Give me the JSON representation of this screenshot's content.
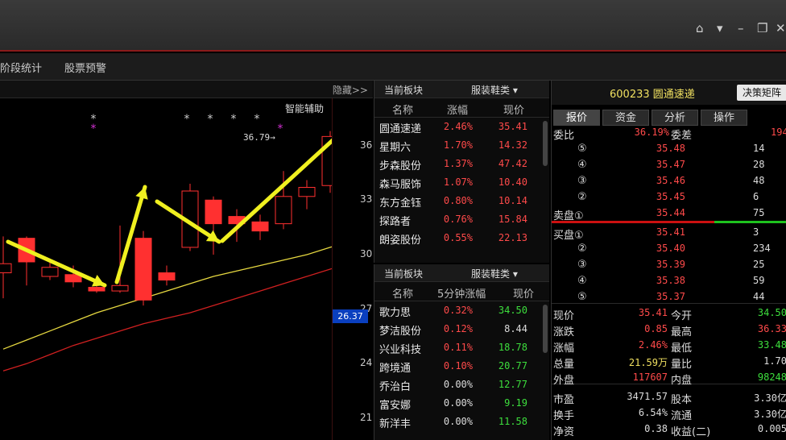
{
  "menubar": {
    "stage_stats": "阶段统计",
    "stock_alert": "股票预警"
  },
  "chart": {
    "hide_label": "隐藏>>",
    "assist_label": "智能辅助",
    "high_marker": "36.79→",
    "current_price": "26.37",
    "y_ticks": [
      "36",
      "33",
      "30",
      "27",
      "24",
      "21"
    ],
    "star_marks": [
      "*",
      "*",
      "*",
      "*",
      "*",
      "*"
    ],
    "purple_marks": [
      "*",
      "*"
    ]
  },
  "chart_data": {
    "type": "candlestick",
    "yaxis_ticks": [
      36,
      33,
      30,
      27,
      24,
      21
    ],
    "ylim": [
      19.8,
      38.6
    ],
    "candles": [
      {
        "open": 29.0,
        "close": 29.5,
        "high": 31.0,
        "low": 27.6
      },
      {
        "open": 30.9,
        "close": 29.6,
        "high": 31.0,
        "low": 28.3
      },
      {
        "open": 28.8,
        "close": 29.3,
        "high": 29.6,
        "low": 28.6
      },
      {
        "open": 28.9,
        "close": 28.5,
        "high": 29.4,
        "low": 28.2
      },
      {
        "open": 28.2,
        "close": 28.0,
        "high": 28.4,
        "low": 27.9
      },
      {
        "open": 28.0,
        "close": 28.3,
        "high": 31.6,
        "low": 27.9
      },
      {
        "open": 30.9,
        "close": 27.5,
        "high": 31.3,
        "low": 27.2
      },
      {
        "open": 29.0,
        "close": 28.6,
        "high": 29.4,
        "low": 28.3
      },
      {
        "open": 30.4,
        "close": 33.5,
        "high": 33.9,
        "low": 30.2
      },
      {
        "open": 33.0,
        "close": 31.7,
        "high": 33.2,
        "low": 30.0
      },
      {
        "open": 32.1,
        "close": 31.7,
        "high": 32.5,
        "low": 30.7
      },
      {
        "open": 31.8,
        "close": 31.3,
        "high": 32.2,
        "low": 30.8
      },
      {
        "open": 31.7,
        "close": 33.2,
        "high": 34.6,
        "low": 31.4
      },
      {
        "open": 33.2,
        "close": 33.7,
        "high": 34.1,
        "low": 32.5
      },
      {
        "open": 33.8,
        "close": 36.5,
        "high": 36.8,
        "low": 33.4
      },
      {
        "open": 36.3,
        "close": 34.9,
        "high": 36.79,
        "low": 34.5
      },
      {
        "open": 34.8,
        "close": 35.9,
        "high": 37.1,
        "low": 33.8
      }
    ],
    "ma_yellow": [
      24.8,
      25.3,
      25.8,
      26.3,
      26.8,
      27.2,
      27.6,
      28.0,
      28.4,
      28.8,
      29.1,
      29.4,
      29.7,
      30.0,
      30.4,
      30.8,
      31.2
    ],
    "ma_red": [
      23.6,
      24.0,
      24.5,
      25.0,
      25.4,
      25.8,
      26.2,
      26.5,
      26.8,
      27.2,
      27.6,
      28.0,
      28.4,
      28.8,
      29.2,
      29.6,
      30.0
    ]
  },
  "sector1": {
    "title": "当前板块",
    "select": "服装鞋类 ▾",
    "headers": [
      "名称",
      "涨幅",
      "现价"
    ],
    "rows": [
      {
        "name": "圆通速递",
        "chg": "2.46%",
        "price": "35.41",
        "color": "up"
      },
      {
        "name": "星期六",
        "chg": "1.70%",
        "price": "14.32",
        "color": "up"
      },
      {
        "name": "步森股份",
        "chg": "1.37%",
        "price": "47.42",
        "color": "up"
      },
      {
        "name": "森马服饰",
        "chg": "1.07%",
        "price": "10.40",
        "color": "up"
      },
      {
        "name": "东方金钰",
        "chg": "0.80%",
        "price": "10.14",
        "color": "up"
      },
      {
        "name": "探路者",
        "chg": "0.76%",
        "price": "15.84",
        "color": "up"
      },
      {
        "name": "朗姿股份",
        "chg": "0.55%",
        "price": "22.13",
        "color": "up"
      }
    ]
  },
  "sector2": {
    "title": "当前板块",
    "select": "服装鞋类 ▾",
    "headers": [
      "名称",
      "5分钟涨幅",
      "现价"
    ],
    "rows": [
      {
        "name": "歌力思",
        "chg": "0.32%",
        "price": "34.50",
        "color": "down"
      },
      {
        "name": "梦洁股份",
        "chg": "0.12%",
        "price": "8.44",
        "color": "flat"
      },
      {
        "name": "兴业科技",
        "chg": "0.11%",
        "price": "18.78",
        "color": "down"
      },
      {
        "name": "跨境通",
        "chg": "0.10%",
        "price": "20.77",
        "color": "down"
      },
      {
        "name": "乔治白",
        "chg": "0.00%",
        "price": "12.77",
        "color": "down"
      },
      {
        "name": "富安娜",
        "chg": "0.00%",
        "price": "9.19",
        "color": "down"
      },
      {
        "name": "新洋丰",
        "chg": "0.00%",
        "price": "11.58",
        "color": "down"
      }
    ]
  },
  "quote": {
    "code_name": "600233 圆通速递",
    "decision_btn": "决策矩阵",
    "tabs": [
      "报价",
      "资金",
      "分析",
      "操作"
    ],
    "weibi_label": "委比",
    "weibi_value": "36.19%",
    "weicha_label": "委差",
    "weicha_value": "194",
    "sell": [
      {
        "lv": "⑤",
        "price": "35.48",
        "vol": "14"
      },
      {
        "lv": "④",
        "price": "35.47",
        "vol": "28"
      },
      {
        "lv": "③",
        "price": "35.46",
        "vol": "48"
      },
      {
        "lv": "②",
        "price": "35.45",
        "vol": "6"
      },
      {
        "lv": "卖盘①",
        "price": "35.44",
        "vol": "75"
      }
    ],
    "buy": [
      {
        "lv": "买盘①",
        "price": "35.41",
        "vol": "3"
      },
      {
        "lv": "②",
        "price": "35.40",
        "vol": "234"
      },
      {
        "lv": "③",
        "price": "35.39",
        "vol": "25"
      },
      {
        "lv": "④",
        "price": "35.38",
        "vol": "59"
      },
      {
        "lv": "⑤",
        "price": "35.37",
        "vol": "44"
      }
    ],
    "stats": [
      {
        "k1": "现价",
        "v1": "35.41",
        "c1": "up",
        "k2": "今开",
        "v2": "34.50",
        "c2": "down"
      },
      {
        "k1": "涨跌",
        "v1": "0.85",
        "c1": "up",
        "k2": "最高",
        "v2": "36.33",
        "c2": "up"
      },
      {
        "k1": "涨幅",
        "v1": "2.46%",
        "c1": "up",
        "k2": "最低",
        "v2": "33.48",
        "c2": "down"
      },
      {
        "k1": "总量",
        "v1": "21.59万",
        "c1": "yellow",
        "k2": "量比",
        "v2": "1.70",
        "c2": "flat"
      },
      {
        "k1": "外盘",
        "v1": "117607",
        "c1": "up",
        "k2": "内盘",
        "v2": "98248",
        "c2": "down"
      },
      {
        "k1": "市盈",
        "v1": "3471.57",
        "c1": "flat",
        "k2": "股本",
        "v2": "3.30亿",
        "c2": "flat"
      },
      {
        "k1": "换手",
        "v1": "6.54%",
        "c1": "flat",
        "k2": "流通",
        "v2": "3.30亿",
        "c2": "flat"
      },
      {
        "k1": "净资",
        "v1": "0.38",
        "c1": "flat",
        "k2": "收益(二)",
        "v2": "0.005",
        "c2": "flat"
      }
    ]
  }
}
